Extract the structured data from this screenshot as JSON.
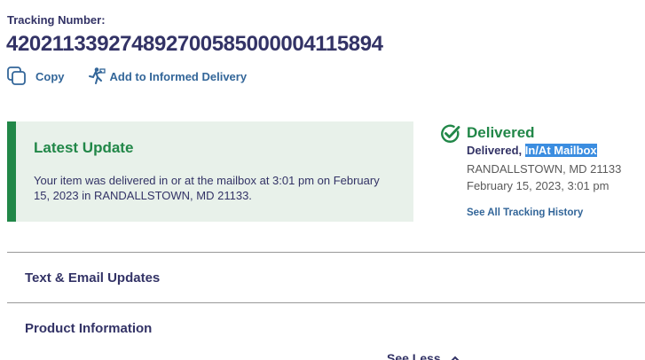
{
  "tracking": {
    "label": "Tracking Number:",
    "number": "420211339274892700585000004115894"
  },
  "actions": {
    "copy_label": "Copy",
    "copy_icon": "copy-icon",
    "informed_label": "Add to Informed Delivery",
    "informed_icon": "informed-delivery-icon"
  },
  "latest_update": {
    "title": "Latest Update",
    "text": "Your item was delivered in or at the mailbox at 3:01 pm on February 15, 2023 in RANDALLSTOWN, MD 21133."
  },
  "status": {
    "icon": "check-circle-icon",
    "title": "Delivered",
    "detail_prefix": "Delivered, ",
    "detail_highlight": "In/At Mailbox",
    "location": "RANDALLSTOWN, MD 21133",
    "datetime": "February 15, 2023, 3:01 pm",
    "history_link": "See All Tracking History"
  },
  "sections": {
    "text_email": "Text & Email Updates",
    "product_info": "Product Information"
  },
  "see_less": {
    "label": "See Less"
  },
  "colors": {
    "brand_navy": "#333366",
    "link_blue": "#336699",
    "success_green": "#218748",
    "update_bg": "#e8f1ea",
    "selection_highlight": "#3b8de0"
  }
}
